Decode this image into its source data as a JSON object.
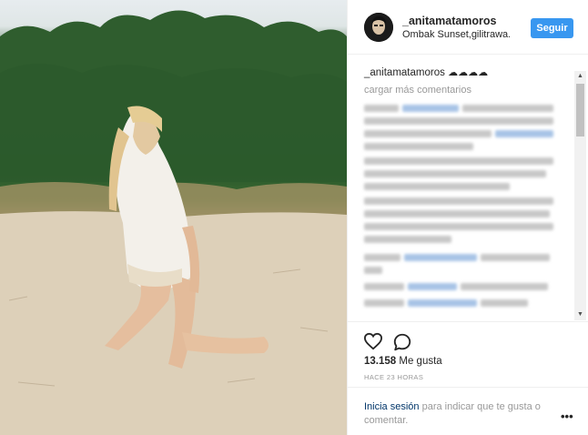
{
  "post": {
    "username": "_anitamatamoros",
    "location": "Ombak Sunset,gilitrawa...",
    "follow_label": "Seguir",
    "caption_user": "_anitamatamoros",
    "caption_text": "☁☁☁☁",
    "load_more_label": "cargar más comentarios",
    "likes_count": "13.158",
    "likes_label": "Me gusta",
    "time_ago": "HACE 23 HORAS",
    "login_link": "Inicia sesión",
    "login_text": " para indicar que te gusta o comentar.",
    "more_options": "•••"
  },
  "icons": {
    "heart": "heart-outline-icon",
    "comment": "comment-bubble-icon",
    "avatar": "profile-avatar",
    "scroll_up": "▲",
    "scroll_down": "▼"
  },
  "colors": {
    "follow_button": "#3897f0",
    "link": "#003569",
    "muted": "#999999",
    "text": "#262626",
    "blurred_mention": "#a8c4e6",
    "blurred_text": "#c8c8c8"
  }
}
